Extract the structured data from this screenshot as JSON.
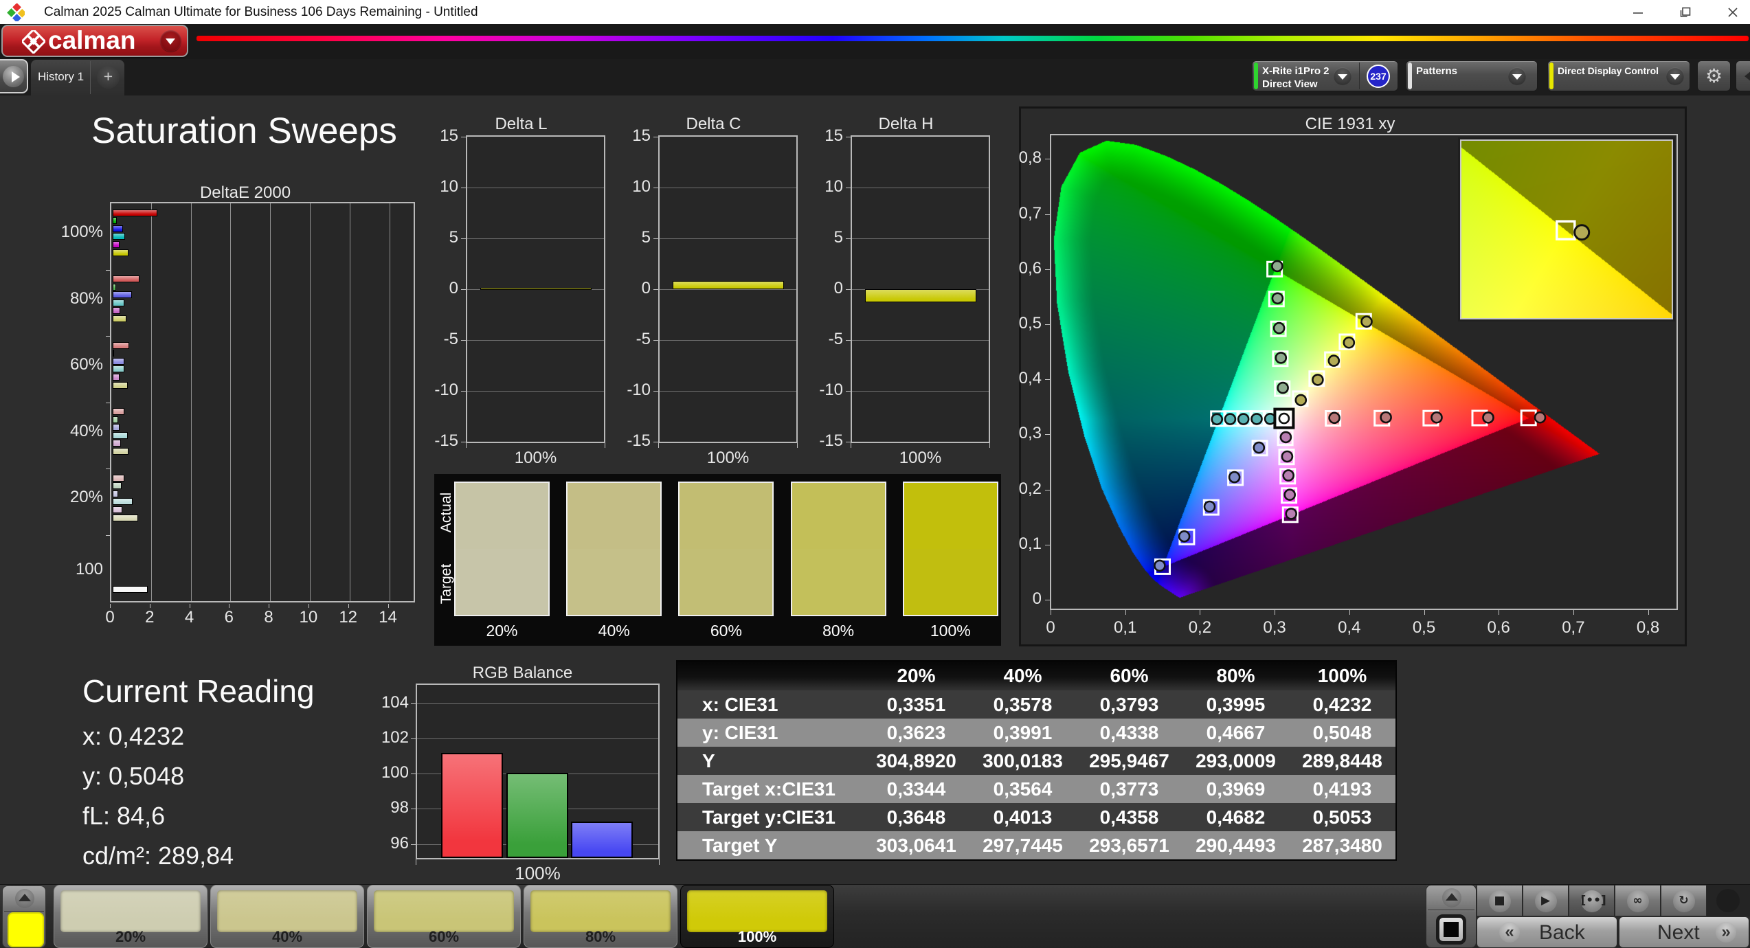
{
  "window": {
    "title": "Calman 2025 Calman Ultimate for Business 106 Days Remaining  - Untitled",
    "controls": [
      "minimize",
      "maximize",
      "close"
    ]
  },
  "brand": {
    "name": "calman"
  },
  "tabs": {
    "active": "History 1",
    "add": "+"
  },
  "toolbar": {
    "meter": {
      "line1": "X-Rite i1Pro 2",
      "line2": "Direct View",
      "badge": "237",
      "accent": "#2fd42f"
    },
    "patterns": {
      "label": "Patterns",
      "accent": "#e0e0e0"
    },
    "display_control": {
      "label": "Direct Display Control",
      "accent": "#e8e800"
    },
    "settings_icon": "gear"
  },
  "page_title": "Saturation Sweeps",
  "current_reading": {
    "title": "Current Reading",
    "lines": [
      "x: 0,4232",
      "y: 0,5048",
      "fL: 84,6",
      "cd/m²: 289,84"
    ]
  },
  "chart_data": [
    {
      "id": "deltae",
      "type": "bar",
      "title": "DeltaE 2000",
      "orientation": "horizontal",
      "xlim": [
        0,
        15.23
      ],
      "xticks": [
        "0",
        "2",
        "4",
        "6",
        "8",
        "10",
        "12",
        "14"
      ],
      "xtick_values": [
        0,
        2,
        4,
        6,
        8,
        10,
        12,
        14
      ],
      "categories": [
        "100%",
        "80%",
        "60%",
        "40%",
        "20%",
        "100"
      ],
      "series_order": [
        "red",
        "green",
        "blue",
        "cyan",
        "magenta",
        "yellow"
      ],
      "groups": [
        {
          "label": "100%",
          "values": [
            2.26,
            0.2,
            0.53,
            0.61,
            0.33,
            0.79
          ],
          "colors": [
            "#c60202",
            "#04b404",
            "#1212e2",
            "#06b6b6",
            "#c404c4",
            "#c6c602"
          ]
        },
        {
          "label": "80%",
          "values": [
            1.35,
            0.17,
            0.96,
            0.58,
            0.38,
            0.7
          ],
          "colors": [
            "#d25c5c",
            "#52b452",
            "#5c5ce2",
            "#66c6c6",
            "#c666c6",
            "#cdcd6a"
          ]
        },
        {
          "label": "60%",
          "values": [
            0.82,
            0.07,
            0.58,
            0.57,
            0.36,
            0.75
          ],
          "colors": [
            "#d67c7c",
            "#7cc07c",
            "#8c8ce0",
            "#8accca",
            "#cc8acc",
            "#cfcf8a"
          ]
        },
        {
          "label": "40%",
          "values": [
            0.57,
            0.27,
            0.36,
            0.75,
            0.41,
            0.79
          ],
          "colors": [
            "#d89e9e",
            "#a2cfa2",
            "#a8a8dc",
            "#a8d8d8",
            "#d0a8d0",
            "#d2d2a2"
          ]
        },
        {
          "label": "20%",
          "values": [
            0.58,
            0.45,
            0.26,
            1.01,
            0.5,
            1.29
          ],
          "colors": [
            "#dcb6b6",
            "#bed2be",
            "#c2c2e0",
            "#bcdcdc",
            "#d8c0d8",
            "#d8d8b6"
          ]
        },
        {
          "label": "100",
          "values": [
            1.78
          ],
          "colors": [
            "#f6f6f6"
          ]
        }
      ]
    },
    {
      "id": "deltaL",
      "type": "bar",
      "title": "Delta L",
      "values": [
        0.12
      ],
      "ylim": [
        -15,
        15
      ],
      "yticks": [
        "15",
        "10",
        "5",
        "0",
        "-5",
        "-10",
        "-15"
      ],
      "ytick_values": [
        15,
        10,
        5,
        0,
        -5,
        -10,
        -15
      ],
      "xlabel": "100%",
      "bar_color": "#c9c905"
    },
    {
      "id": "deltaC",
      "type": "bar",
      "title": "Delta C",
      "values": [
        0.8
      ],
      "ylim": [
        -15,
        15
      ],
      "yticks": [
        "15",
        "10",
        "5",
        "0",
        "-5",
        "-10",
        "-15"
      ],
      "ytick_values": [
        15,
        10,
        5,
        0,
        -5,
        -10,
        -15
      ],
      "xlabel": "100%",
      "bar_color": "#c9c905"
    },
    {
      "id": "deltaH",
      "type": "bar",
      "title": "Delta H",
      "values": [
        -1.3
      ],
      "ylim": [
        -15,
        15
      ],
      "yticks": [
        "15",
        "10",
        "5",
        "0",
        "-5",
        "-10",
        "-15"
      ],
      "ytick_values": [
        15,
        10,
        5,
        0,
        -5,
        -10,
        -15
      ],
      "xlabel": "100%",
      "bar_color": "#c9c905"
    },
    {
      "id": "swatches",
      "type": "table",
      "title": "Actual vs Target color patches",
      "row_labels": [
        "Actual",
        "Target"
      ],
      "columns": [
        {
          "label": "20%",
          "actual": "#c6c4a6",
          "target": "#c7c5a9"
        },
        {
          "label": "40%",
          "actual": "#c4be86",
          "target": "#c5c089"
        },
        {
          "label": "60%",
          "actual": "#c2bd72",
          "target": "#c2be75"
        },
        {
          "label": "80%",
          "actual": "#c3bf58",
          "target": "#c3c05b"
        },
        {
          "label": "100%",
          "actual": "#c2bf0c",
          "target": "#c1be10"
        }
      ]
    },
    {
      "id": "cie",
      "type": "scatter",
      "title": "CIE 1931 xy",
      "xlim": [
        0,
        0.8409
      ],
      "ylim": [
        0,
        0.8442
      ],
      "xticks": [
        "0",
        "0,1",
        "0,2",
        "0,3",
        "0,4",
        "0,5",
        "0,6",
        "0,7",
        "0,8"
      ],
      "yticks": [
        "0",
        "0,1",
        "0,2",
        "0,3",
        "0,4",
        "0,5",
        "0,6",
        "0,7",
        "0,8"
      ],
      "tick_values": [
        0,
        0.1,
        0.2,
        0.3,
        0.4,
        0.5,
        0.6,
        0.7,
        0.8
      ],
      "white_point": {
        "x": 0.3127,
        "y": 0.329
      },
      "gamut_triangle": [
        [
          0.64,
          0.33
        ],
        [
          0.3,
          0.6
        ],
        [
          0.15,
          0.06
        ]
      ],
      "series": [
        {
          "name": "red",
          "targets": [
            [
              0.3782,
              0.3292
            ],
            [
              0.4436,
              0.3294
            ],
            [
              0.5091,
              0.3296
            ],
            [
              0.5745,
              0.3298
            ],
            [
              0.64,
              0.33
            ]
          ],
          "measured": [
            [
              0.38,
              0.33
            ],
            [
              0.449,
              0.331
            ],
            [
              0.517,
              0.3308
            ],
            [
              0.586,
              0.3305
            ],
            [
              0.6555,
              0.3308
            ]
          ]
        },
        {
          "name": "green",
          "targets": [
            [
              0.3102,
              0.3832
            ],
            [
              0.3076,
              0.4374
            ],
            [
              0.3051,
              0.4916
            ],
            [
              0.3025,
              0.5458
            ],
            [
              0.3,
              0.6
            ]
          ],
          "measured": [
            [
              0.311,
              0.3845
            ],
            [
              0.3085,
              0.439
            ],
            [
              0.306,
              0.493
            ],
            [
              0.304,
              0.547
            ],
            [
              0.3035,
              0.6055
            ]
          ]
        },
        {
          "name": "blue",
          "targets": [
            [
              0.2802,
              0.2752
            ],
            [
              0.2476,
              0.2214
            ],
            [
              0.2151,
              0.1676
            ],
            [
              0.1825,
              0.1138
            ],
            [
              0.15,
              0.06
            ]
          ],
          "measured": [
            [
              0.279,
              0.276
            ],
            [
              0.2462,
              0.2225
            ],
            [
              0.213,
              0.169
            ],
            [
              0.179,
              0.115
            ],
            [
              0.1462,
              0.0618
            ]
          ]
        },
        {
          "name": "cyan",
          "targets": [
            [
              0.2951,
              0.3289
            ],
            [
              0.2775,
              0.3289
            ],
            [
              0.2599,
              0.3288
            ],
            [
              0.2423,
              0.3288
            ],
            [
              0.2247,
              0.3287
            ]
          ],
          "measured": [
            [
              0.294,
              0.3282
            ],
            [
              0.276,
              0.328
            ],
            [
              0.2582,
              0.3278
            ],
            [
              0.2405,
              0.3278
            ],
            [
              0.2228,
              0.3275
            ]
          ]
        },
        {
          "name": "magenta",
          "targets": [
            [
              0.3143,
              0.294
            ],
            [
              0.316,
              0.2591
            ],
            [
              0.3176,
              0.2241
            ],
            [
              0.3193,
              0.1892
            ],
            [
              0.3209,
              0.1542
            ]
          ],
          "measured": [
            [
              0.315,
              0.295
            ],
            [
              0.3168,
              0.26
            ],
            [
              0.3185,
              0.2255
            ],
            [
              0.3203,
              0.1905
            ],
            [
              0.3222,
              0.156
            ]
          ]
        },
        {
          "name": "yellow",
          "targets": [
            [
              0.3344,
              0.3648
            ],
            [
              0.3564,
              0.4013
            ],
            [
              0.3773,
              0.4358
            ],
            [
              0.3969,
              0.4682
            ],
            [
              0.4193,
              0.5053
            ]
          ],
          "measured": [
            [
              0.3351,
              0.3623
            ],
            [
              0.3578,
              0.3991
            ],
            [
              0.3793,
              0.4338
            ],
            [
              0.3995,
              0.4667
            ],
            [
              0.4232,
              0.5048
            ]
          ]
        }
      ],
      "inset": {
        "window": {
          "x0": 0.394,
          "x1": 0.445,
          "y0": 0.484,
          "y1": 0.527
        },
        "target": [
          0.4193,
          0.5053
        ],
        "measured": [
          0.4232,
          0.5048
        ]
      }
    },
    {
      "id": "rgbbalance",
      "type": "bar",
      "title": "RGB Balance",
      "categories": [
        "red",
        "green",
        "blue"
      ],
      "values": [
        101.2,
        100.05,
        97.28
      ],
      "colors": [
        "#f2363e",
        "#3aa03a",
        "#4747f2"
      ],
      "ylim": [
        95.2,
        105.05
      ],
      "yticks": [
        "104",
        "102",
        "100",
        "98",
        "96"
      ],
      "ytick_values": [
        104,
        102,
        100,
        98,
        96
      ],
      "xlabel": "100%"
    },
    {
      "id": "datatable",
      "type": "table",
      "headers": [
        "",
        "20%",
        "40%",
        "60%",
        "80%",
        "100%"
      ],
      "rows": [
        {
          "label": "x: CIE31",
          "values": [
            "0,3351",
            "0,3578",
            "0,3793",
            "0,3995",
            "0,4232"
          ]
        },
        {
          "label": "y: CIE31",
          "values": [
            "0,3623",
            "0,3991",
            "0,4338",
            "0,4667",
            "0,5048"
          ]
        },
        {
          "label": "Y",
          "values": [
            "304,8920",
            "300,0183",
            "295,9467",
            "293,0009",
            "289,8448"
          ]
        },
        {
          "label": "Target x:CIE31",
          "values": [
            "0,3344",
            "0,3564",
            "0,3773",
            "0,3969",
            "0,4193"
          ]
        },
        {
          "label": "Target y:CIE31",
          "values": [
            "0,3648",
            "0,4013",
            "0,4358",
            "0,4682",
            "0,5053"
          ]
        },
        {
          "label": "Target Y",
          "values": [
            "303,0641",
            "297,7445",
            "293,6571",
            "290,4493",
            "287,3480"
          ]
        }
      ]
    }
  ],
  "bottom_bar": {
    "patterns": [
      {
        "label": "20%",
        "color": "#cecdb1",
        "selected": false
      },
      {
        "label": "40%",
        "color": "#cbc68e",
        "selected": false
      },
      {
        "label": "60%",
        "color": "#c9c577",
        "selected": false
      },
      {
        "label": "80%",
        "color": "#cac45c",
        "selected": false
      },
      {
        "label": "100%",
        "color": "#d0ca08",
        "selected": true
      }
    ],
    "transport_icons": [
      "stop",
      "play",
      "frame",
      "infinity",
      "loop"
    ],
    "back_label": "Back",
    "next_label": "Next"
  }
}
